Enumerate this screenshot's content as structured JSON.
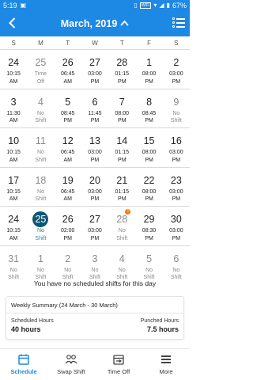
{
  "status_bar": {
    "time": "5:19",
    "wifi_label": "WIFI",
    "battery": "67%"
  },
  "header": {
    "title": "March, 2019"
  },
  "weekdays": [
    "S",
    "M",
    "T",
    "W",
    "T",
    "F",
    "S"
  ],
  "weeks": [
    [
      {
        "day": "24",
        "shift": [
          "10:15",
          "AM"
        ],
        "muted": false
      },
      {
        "day": "25",
        "shift": [
          "Time",
          "Off"
        ],
        "muted": true
      },
      {
        "day": "26",
        "shift": [
          "06:45",
          "AM"
        ],
        "muted": false
      },
      {
        "day": "27",
        "shift": [
          "03:00",
          "PM"
        ],
        "muted": false
      },
      {
        "day": "28",
        "shift": [
          "01:15",
          "PM"
        ],
        "muted": false
      },
      {
        "day": "1",
        "shift": [
          "08:00",
          "PM"
        ],
        "muted": false
      },
      {
        "day": "2",
        "shift": [
          "03:00",
          "PM"
        ],
        "muted": false
      }
    ],
    [
      {
        "day": "3",
        "shift": [
          "11:30",
          "AM"
        ],
        "muted": false
      },
      {
        "day": "4",
        "shift": [
          "No",
          "Shift"
        ],
        "muted": true
      },
      {
        "day": "5",
        "shift": [
          "08:45",
          "PM"
        ],
        "muted": false
      },
      {
        "day": "6",
        "shift": [
          "11:45",
          "PM"
        ],
        "muted": false
      },
      {
        "day": "7",
        "shift": [
          "08:00",
          "PM"
        ],
        "muted": false
      },
      {
        "day": "8",
        "shift": [
          "08:45",
          "PM"
        ],
        "muted": false
      },
      {
        "day": "9",
        "shift": [
          "No",
          "Shift"
        ],
        "muted": true
      }
    ],
    [
      {
        "day": "10",
        "shift": [
          "10:15",
          "AM"
        ],
        "muted": false
      },
      {
        "day": "11",
        "shift": [
          "No",
          "Shift"
        ],
        "muted": true
      },
      {
        "day": "12",
        "shift": [
          "06:45",
          "AM"
        ],
        "muted": false
      },
      {
        "day": "13",
        "shift": [
          "03:00",
          "PM"
        ],
        "muted": false
      },
      {
        "day": "14",
        "shift": [
          "01:15",
          "PM"
        ],
        "muted": false
      },
      {
        "day": "15",
        "shift": [
          "08:00",
          "PM"
        ],
        "muted": false
      },
      {
        "day": "16",
        "shift": [
          "03:00",
          "PM"
        ],
        "muted": false
      }
    ],
    [
      {
        "day": "17",
        "shift": [
          "10:15",
          "AM"
        ],
        "muted": false
      },
      {
        "day": "18",
        "shift": [
          "No",
          "Shift"
        ],
        "muted": true
      },
      {
        "day": "19",
        "shift": [
          "06:45",
          "AM"
        ],
        "muted": false
      },
      {
        "day": "20",
        "shift": [
          "03:00",
          "PM"
        ],
        "muted": false
      },
      {
        "day": "21",
        "shift": [
          "01:15",
          "PM"
        ],
        "muted": false
      },
      {
        "day": "22",
        "shift": [
          "08:00",
          "PM"
        ],
        "muted": false
      },
      {
        "day": "23",
        "shift": [
          "03:00",
          "PM"
        ],
        "muted": false
      }
    ],
    [
      {
        "day": "24",
        "shift": [
          "10:15",
          "AM"
        ],
        "muted": false
      },
      {
        "day": "25",
        "shift": [
          "No",
          "Shift"
        ],
        "muted": false,
        "today": true
      },
      {
        "day": "26",
        "shift": [
          "02:00",
          "PM"
        ],
        "muted": false
      },
      {
        "day": "27",
        "shift": [
          "03:00",
          "PM"
        ],
        "muted": false
      },
      {
        "day": "28",
        "shift": [
          "No",
          "Shift"
        ],
        "muted": true,
        "badge": "!"
      },
      {
        "day": "29",
        "shift": [
          "08:30",
          "PM"
        ],
        "muted": false
      },
      {
        "day": "30",
        "shift": [
          "03:00",
          "PM"
        ],
        "muted": false
      }
    ],
    [
      {
        "day": "31",
        "shift": [
          "No",
          "Shift"
        ],
        "muted": true
      },
      {
        "day": "1",
        "shift": [
          "No",
          "Shift"
        ],
        "muted": true
      },
      {
        "day": "2",
        "shift": [
          "No",
          "Shift"
        ],
        "muted": true
      },
      {
        "day": "3",
        "shift": [
          "No",
          "Shift"
        ],
        "muted": true
      },
      {
        "day": "4",
        "shift": [
          "No",
          "Shift"
        ],
        "muted": true
      },
      {
        "day": "5",
        "shift": [
          "No",
          "Shift"
        ],
        "muted": true
      },
      {
        "day": "6",
        "shift": [
          "No",
          "Shift"
        ],
        "muted": true
      }
    ]
  ],
  "message": "You have no scheduled shifts for this day",
  "summary": {
    "title": "Weekly Summary (24 March - 30 March)",
    "scheduled_label": "Scheduled Hours",
    "scheduled_value": "40 hours",
    "punched_label": "Punched Hours",
    "punched_value": "7.5 hours"
  },
  "nav": [
    {
      "label": "Schedule",
      "icon": "calendar-icon",
      "active": true
    },
    {
      "label": "Swap Shift",
      "icon": "swap-people-icon",
      "active": false
    },
    {
      "label": "Time Off",
      "icon": "time-off-icon",
      "active": false
    },
    {
      "label": "More",
      "icon": "more-icon",
      "active": false
    }
  ],
  "colors": {
    "primary": "#1e88e5",
    "today": "#0d5676",
    "badge": "#f57c00",
    "muted": "#8a8a8a"
  }
}
